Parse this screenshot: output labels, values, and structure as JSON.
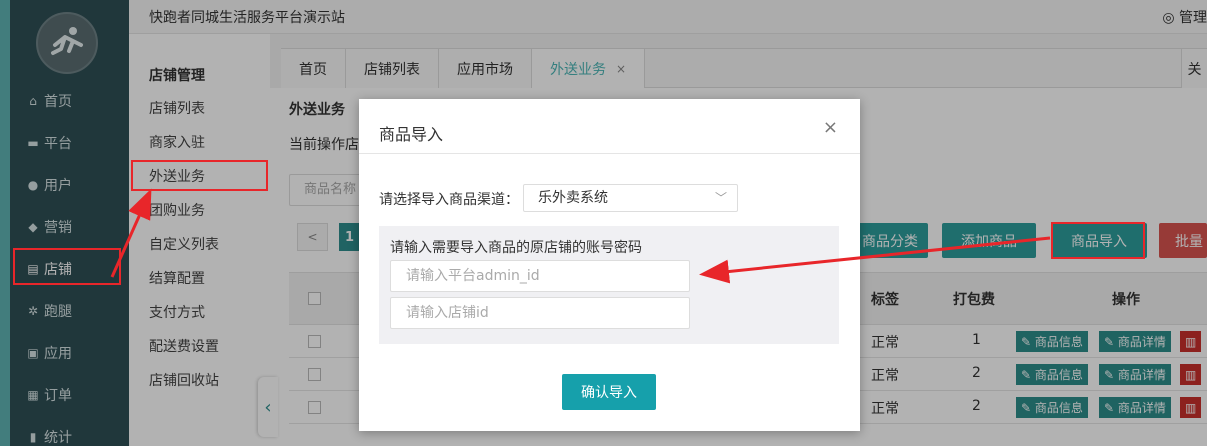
{
  "header": {
    "site_title": "快跑者同城生活服务平台演示站",
    "user_label": "管理"
  },
  "nav": {
    "items": [
      {
        "label": "首页",
        "icon": "home-icon"
      },
      {
        "label": "平台",
        "icon": "monitor-icon"
      },
      {
        "label": "用户",
        "icon": "user-icon"
      },
      {
        "label": "营销",
        "icon": "tag-icon"
      },
      {
        "label": "店铺",
        "icon": "store-icon"
      },
      {
        "label": "跑腿",
        "icon": "bike-icon"
      },
      {
        "label": "应用",
        "icon": "app-icon"
      },
      {
        "label": "订单",
        "icon": "order-icon"
      },
      {
        "label": "统计",
        "icon": "chart-icon"
      }
    ]
  },
  "submenu": {
    "title": "店铺管理",
    "items": [
      "店铺列表",
      "商家入驻",
      "外送业务",
      "团购业务",
      "自定义列表",
      "结算配置",
      "支付方式",
      "配送费设置",
      "店铺回收站"
    ]
  },
  "tabs": {
    "items": [
      "首页",
      "店铺列表",
      "应用市场",
      "外送业务"
    ],
    "close": "×",
    "right_fragment": "关"
  },
  "content": {
    "heading": "外送业务",
    "store_info": "当前操作店",
    "search_placeholder": "商品名称",
    "pager_prev": "<",
    "pager_current": "1",
    "buttons": {
      "category": "商品分类",
      "add": "添加商品",
      "import": "商品导入",
      "batch": "批量"
    },
    "table": {
      "headers": {
        "tag": "标签",
        "packing_fee": "打包费",
        "actions": "操作"
      },
      "rows": [
        {
          "tag": "正常",
          "packing_fee": "1"
        },
        {
          "tag": "正常",
          "packing_fee": "2"
        },
        {
          "tag": "正常",
          "packing_fee": "2"
        }
      ],
      "row_actions": {
        "info": "商品信息",
        "detail": "商品详情"
      }
    }
  },
  "modal": {
    "title": "商品导入",
    "close": "×",
    "channel_label": "请选择导入商品渠道：",
    "channel_value": "乐外卖系统",
    "credentials_label": "请输入需要导入商品的原店铺的账号密码",
    "admin_id_placeholder": "请输入平台admin_id",
    "store_id_placeholder": "请输入店铺id",
    "confirm_label": "确认导入"
  },
  "colors": {
    "accent": "#2d9e9c",
    "annotation": "#e8262a",
    "danger": "#d9534f"
  }
}
